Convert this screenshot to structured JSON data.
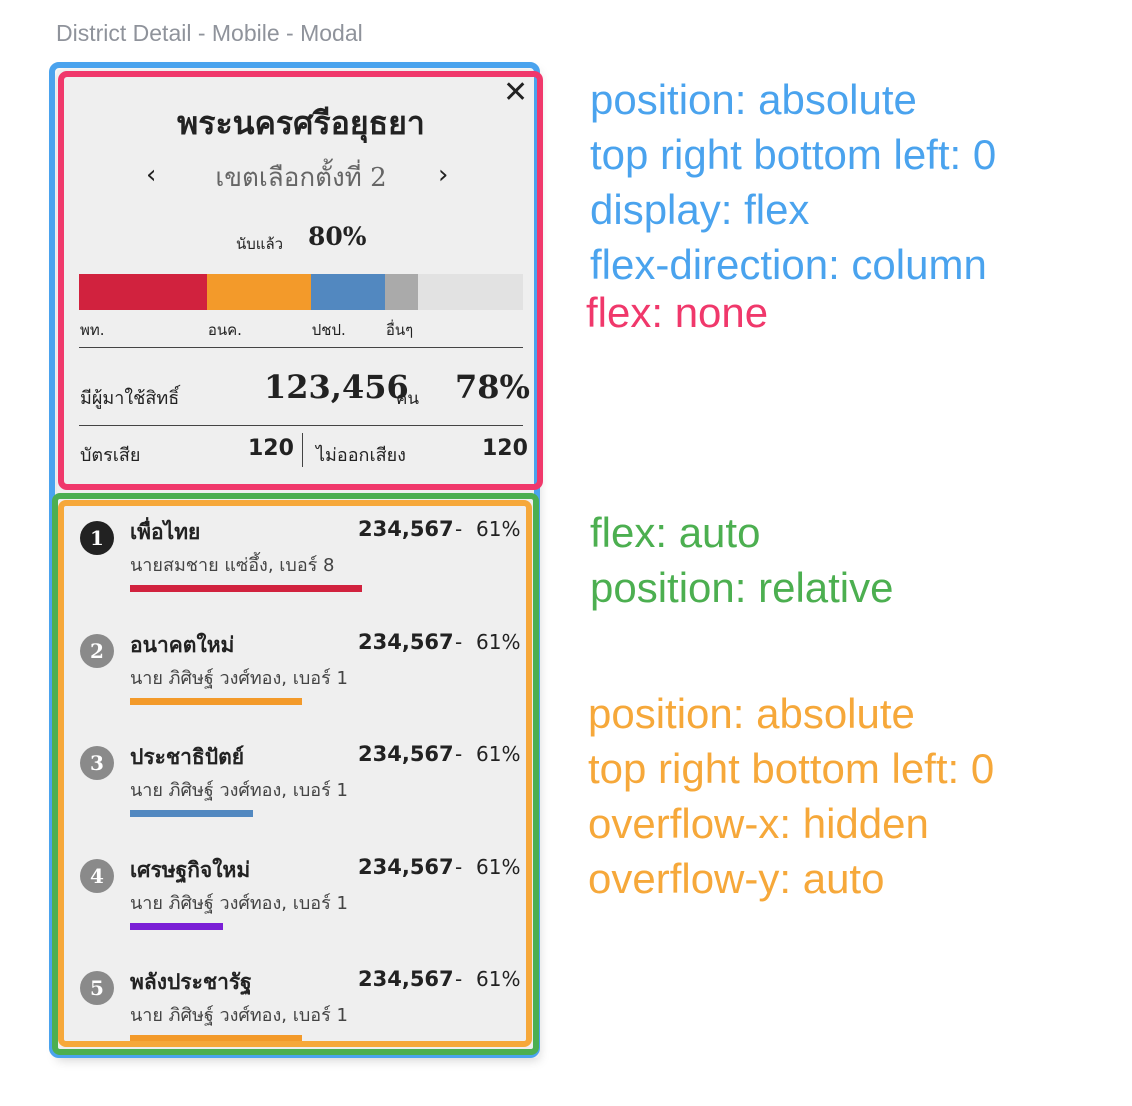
{
  "page_label": "District Detail - Mobile - Modal",
  "header": {
    "close_icon": "close-icon",
    "close_glyph": "✕",
    "province": "พระนครศรีอยุธยา",
    "prev_glyph": "‹",
    "next_glyph": "›",
    "district": "เขตเลือกตั้งที่ 2",
    "count_label": "นับแล้ว",
    "count_pct": "80%"
  },
  "bar": {
    "segments": [
      {
        "label": "พท.",
        "color": "#d1223e",
        "fraction": 0.288
      },
      {
        "label": "อนค.",
        "color": "#f39a2a",
        "fraction": 0.234
      },
      {
        "label": "ปชป.",
        "color": "#5288c0",
        "fraction": 0.167
      },
      {
        "label": "อื่นๆ",
        "color": "#aaaaaa",
        "fraction": 0.074
      }
    ],
    "remaining_color": "#e2e2e2"
  },
  "turnout": {
    "label": "มีผู้มาใช้สิทธิ์",
    "value": "123,456",
    "unit": "คน",
    "pct": "78%"
  },
  "ballots": {
    "invalid_label": "บัตรเสีย",
    "invalid_value": "120",
    "novote_label": "ไม่ออกเสียง",
    "novote_value": "120"
  },
  "parties": [
    {
      "rank": "1",
      "name": "เพื่อไทย",
      "votes": "234,567",
      "sep": "-",
      "pct": "61%",
      "candidate": "นายสมชาย แซ่อึ้ง, เบอร์ 8",
      "color": "#d1223e",
      "line_fraction": 1.0,
      "rank_bg": "#222222"
    },
    {
      "rank": "2",
      "name": "อนาคตใหม่",
      "votes": "234,567",
      "sep": "-",
      "pct": "61%",
      "candidate": "นาย ภิศิษฐ์ วงศ์ทอง, เบอร์ 1",
      "color": "#f39a2a",
      "line_fraction": 0.74,
      "rank_bg": "#8a8a8a"
    },
    {
      "rank": "3",
      "name": "ประชาธิปัตย์",
      "votes": "234,567",
      "sep": "-",
      "pct": "61%",
      "candidate": "นาย ภิศิษฐ์ วงศ์ทอง, เบอร์ 1",
      "color": "#5288c0",
      "line_fraction": 0.53,
      "rank_bg": "#8a8a8a"
    },
    {
      "rank": "4",
      "name": "เศรษฐกิจใหม่",
      "votes": "234,567",
      "sep": "-",
      "pct": "61%",
      "candidate": "นาย ภิศิษฐ์ วงศ์ทอง, เบอร์ 1",
      "color": "#7b1fd6",
      "line_fraction": 0.4,
      "rank_bg": "#8a8a8a"
    },
    {
      "rank": "5",
      "name": "พลังประชารัฐ",
      "votes": "234,567",
      "sep": "-",
      "pct": "61%",
      "candidate": "นาย ภิศิษฐ์ วงศ์ทอง, เบอร์ 1",
      "color": "#f39a2a",
      "line_fraction": 0.74,
      "rank_bg": "#8a8a8a"
    }
  ],
  "annotations": {
    "blue": [
      "position: absolute",
      "top right bottom left: 0",
      "display: flex",
      "flex-direction: column"
    ],
    "pink": [
      "flex: none"
    ],
    "green": [
      "flex: auto",
      "position: relative"
    ],
    "orange": [
      "position: absolute",
      "top right bottom left: 0",
      "overflow-x: hidden",
      "overflow-y: auto"
    ]
  },
  "colors": {
    "outline_blue": "#4aa3ee",
    "outline_pink": "#f0386b",
    "outline_green": "#4caf50",
    "outline_orange": "#f6a83a"
  }
}
